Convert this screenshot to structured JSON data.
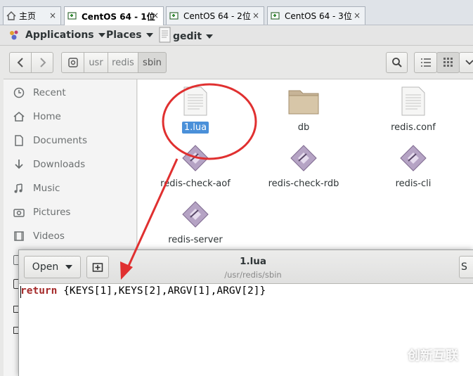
{
  "vm_tabs": [
    {
      "label": "主页",
      "active": false
    },
    {
      "label": "CentOS 64 - 1位",
      "active": true
    },
    {
      "label": "CentOS 64 - 2位",
      "active": false
    },
    {
      "label": "CentOS 64 - 3位",
      "active": false
    }
  ],
  "tab_close_glyph": "×",
  "top_bar": {
    "applications": "Applications",
    "places": "Places",
    "app_name": "gedit"
  },
  "path_bar": [
    "usr",
    "redis",
    "sbin"
  ],
  "sidebar": [
    {
      "label": "Recent",
      "icon": "clock-icon"
    },
    {
      "label": "Home",
      "icon": "home-icon"
    },
    {
      "label": "Documents",
      "icon": "document-icon"
    },
    {
      "label": "Downloads",
      "icon": "download-icon"
    },
    {
      "label": "Music",
      "icon": "music-icon"
    },
    {
      "label": "Pictures",
      "icon": "camera-icon"
    },
    {
      "label": "Videos",
      "icon": "video-icon"
    }
  ],
  "files": [
    {
      "name": "1.lua",
      "type": "text",
      "selected": true
    },
    {
      "name": "db",
      "type": "folder",
      "selected": false
    },
    {
      "name": "redis.conf",
      "type": "text",
      "selected": false
    },
    {
      "name": "redis-check-aof",
      "type": "executable",
      "selected": false
    },
    {
      "name": "redis-check-rdb",
      "type": "executable",
      "selected": false
    },
    {
      "name": "redis-cli",
      "type": "executable",
      "selected": false
    },
    {
      "name": "redis-server",
      "type": "executable",
      "selected": false
    }
  ],
  "gedit": {
    "open_label": "Open",
    "title": "1.lua",
    "subtitle": "/usr/redis/sbin",
    "code_keyword": "return",
    "code_rest": " {KEYS[1],KEYS[2],ARGV[1],ARGV[2]}",
    "save_label_partial": "S"
  },
  "watermark": "创新互联",
  "colors": {
    "selection": "#4a90d9",
    "keyword": "#a52a2a",
    "annotation": "#e03030"
  }
}
